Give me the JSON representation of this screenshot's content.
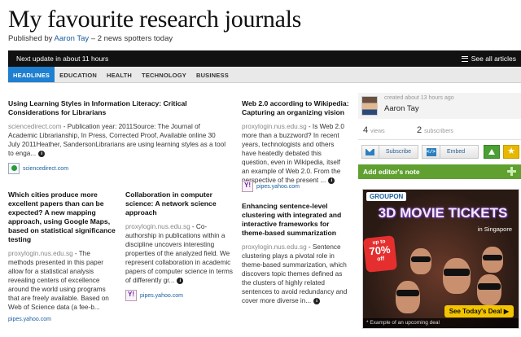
{
  "header": {
    "title": "My favourite research journals",
    "published_by": "Published by",
    "author": "Aaron Tay",
    "spotters": "– 2 news spotters today"
  },
  "topbar": {
    "next_update": "Next update in about 11 hours",
    "see_all": "See all articles"
  },
  "tabs": [
    "HEADLINES",
    "EDUCATION",
    "HEALTH",
    "TECHNOLOGY",
    "BUSINESS"
  ],
  "stories": [
    {
      "title": "Using Learning Styles in Information Literacy: Critical Considerations for Librarians",
      "source": "sciencedirect.com",
      "excerpt": " - Publication year: 2011Source: The Journal of Academic Librarianship, In Press, Corrected Proof, Available online 30 July 2011Heather, SandersonLibrarians are using learning styles as a tool to enga...",
      "footer": "sciencedirect.com"
    },
    {
      "title": "Web 2.0 according to Wikipedia: Capturing an organizing vision",
      "source": "proxylogin.nus.edu.sg",
      "excerpt": " - Is Web 2.0 more than a buzzword? In recent years, technologists and others have heatedly debated this question, even in Wikipedia, itself an example of Web 2.0. From the perspective of the present ...",
      "footer": "pipes.yahoo.com"
    },
    {
      "title": "Which cities produce more excellent papers than can be expected? A new mapping approach, using Google Maps, based on statistical significance testing",
      "source": "proxylogin.nus.edu.sg",
      "excerpt": " - The methods presented in this paper allow for a statistical analysis revealing centers of excellence around the world using programs that are freely available. Based on Web of Science data (a fee-b...",
      "footer": "pipes.yahoo.com"
    },
    {
      "title": "Collaboration in computer science: A network science approach",
      "source": "proxylogin.nus.edu.sg",
      "excerpt": " - Co-authorship in publications within a discipline uncovers interesting properties of the analyzed field. We represent collaboration in academic papers of computer science in terms of differently gr...",
      "footer": "pipes.yahoo.com"
    },
    {
      "title": "Enhancing sentence-level clustering with integrated and interactive frameworks for theme-based summarization",
      "source": "proxylogin.nus.edu.sg",
      "excerpt": " - Sentence clustering plays a pivotal role in theme-based summarization, which discovers topic themes defined as the clusters of highly related sentences to avoid redundancy and cover more diverse in..."
    }
  ],
  "sidebar": {
    "created": "created about 13 hours ago",
    "author": "Aaron Tay",
    "views_count": "4",
    "views_label": "views",
    "subs_count": "2",
    "subs_label": "subscribers",
    "subscribe": "Subscribe",
    "embed": "Embed",
    "add_note": "Add editor's note"
  },
  "ad": {
    "brand": "GROUPON",
    "headline": "3D MOVIE TICKETS",
    "sub": "in Singapore",
    "badge_up": "up to",
    "badge_pct": "70%",
    "badge_off": "off",
    "cta": "See Today's Deal ▶",
    "fine": "* Example of an upcoming deal"
  },
  "colors": {
    "tab_active": "#1f7fd0",
    "add_note_bg": "#5fa030",
    "link": "#1a5ea0"
  }
}
